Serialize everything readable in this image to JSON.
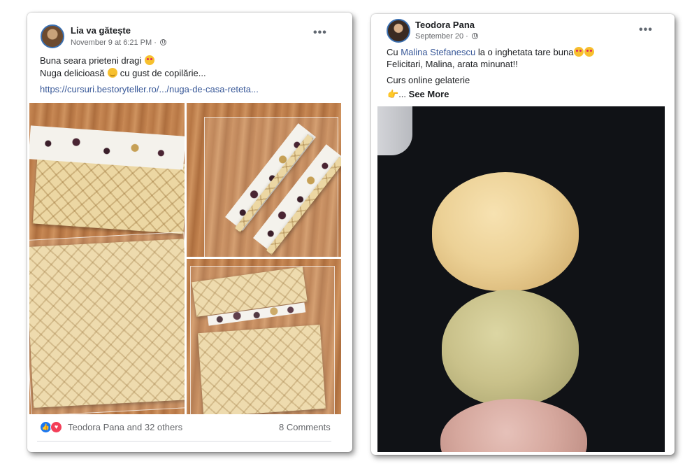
{
  "left_post": {
    "author": "Lia va gătește",
    "meta": "November 9 at 6:21 PM ·",
    "line1": "Buna seara prieteni dragi",
    "line2": "Nuga delicioasă",
    "line2_tail": "cu gust de copilărie...",
    "link": "https://cursuri.bestoryteller.ro/.../nuga-de-casa-reteta...",
    "reactions_text": "Teodora Pana and 32 others",
    "comments": "8 Comments",
    "like_glyph": "👍",
    "love_glyph": "♥",
    "icons": [
      "avatar",
      "globe-icon",
      "more-options-icon",
      "like-reaction-icon",
      "love-reaction-icon",
      "heart-eyes-emoji",
      "smile-emoji"
    ]
  },
  "right_post": {
    "author": "Teodora Pana",
    "meta": "September 20 ·",
    "line1_prefix": "Cu",
    "line1_tag": "Malina Stefanescu",
    "line1_suffix": "la o inghetata tare buna",
    "line2": "Felicitari, Malina, arata minunat!!",
    "line3": "Curs online gelaterie",
    "see_more_prefix": "...",
    "see_more": "See More",
    "more_glyph": "•••",
    "icons": [
      "avatar",
      "globe-icon",
      "more-options-icon",
      "pointing-hand-emoji",
      "heart-eyes-emoji"
    ]
  },
  "colors": {
    "link": "#385898",
    "like": "#1877f2",
    "love": "#f33e58",
    "text": "#1c1e21",
    "meta": "#65676b"
  }
}
